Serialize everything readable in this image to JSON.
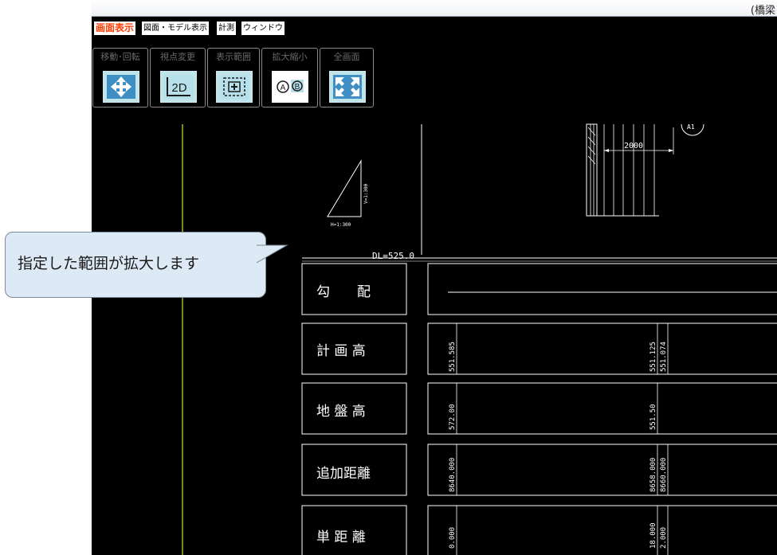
{
  "window": {
    "title": "(橋梁"
  },
  "menubar": {
    "items": [
      {
        "label": "画面表示",
        "active": true
      },
      {
        "label": "図面・モデル表示",
        "active": false
      },
      {
        "label": "計測",
        "active": false
      },
      {
        "label": "ウィンドウ",
        "active": false
      }
    ]
  },
  "toolbar": {
    "groups": [
      {
        "label": "移動･回転",
        "icon": "move-arrows-icon"
      },
      {
        "label": "視点変更",
        "icon": "2d-view-icon",
        "icon_text": "2D"
      },
      {
        "label": "表示範囲",
        "icon": "zoom-range-icon"
      },
      {
        "label": "拡大縮小",
        "icon": "zoom-ab-icon",
        "icon_text_a": "A",
        "icon_text_b": "B"
      },
      {
        "label": "全画面",
        "icon": "fullscreen-icon"
      }
    ]
  },
  "drawing": {
    "scale_h": "H=1:300",
    "scale_v": "V=1:300",
    "datum": "DL=525.0",
    "dimension": "2000",
    "station_mark": "A1",
    "rows": [
      {
        "label": "勾　　配",
        "values": []
      },
      {
        "label": "計 画 高",
        "values": [
          "551.585",
          "551.125",
          "551.074"
        ]
      },
      {
        "label": "地 盤 高",
        "values": [
          "572.00",
          "551.50"
        ]
      },
      {
        "label": "追加距離",
        "values": [
          "8640.000",
          "8658.000",
          "8660.000"
        ]
      },
      {
        "label": "単 距 離",
        "values": [
          "0.000",
          "18.000",
          "2.000"
        ]
      }
    ]
  },
  "callout": {
    "text": "指定した範囲が拡大します"
  },
  "colors": {
    "active_menu": "#ff3c00",
    "guide_line": "#d8df3a",
    "canvas": "#000000",
    "callout_bg": "#dde9f5"
  }
}
